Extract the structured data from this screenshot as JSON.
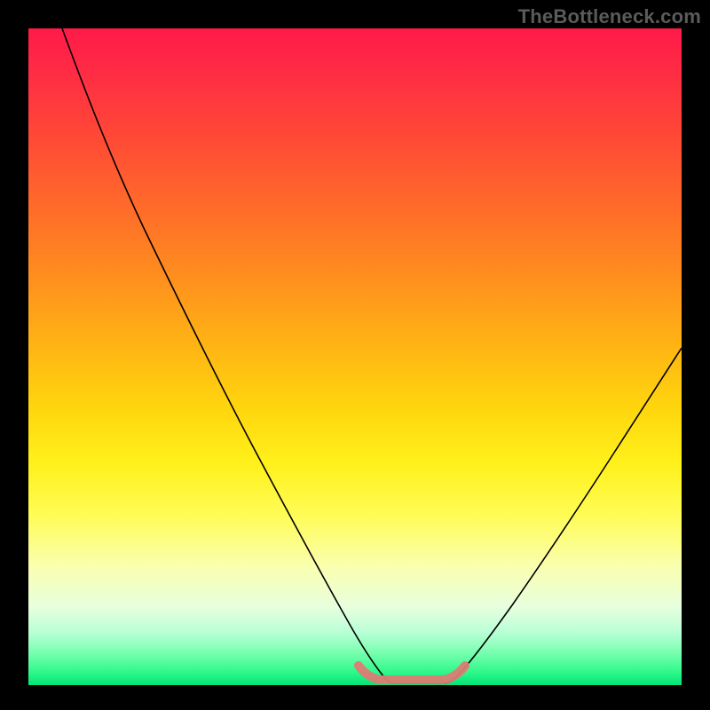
{
  "watermark": "TheBottleneck.com",
  "colors": {
    "background": "#000000",
    "gradient_top": "#ff1a48",
    "gradient_bottom": "#00e676",
    "curve": "#000000",
    "bottom_mark": "#de7b74"
  },
  "chart_data": {
    "type": "line",
    "title": "",
    "xlabel": "",
    "ylabel": "",
    "xlim": [
      0,
      100
    ],
    "ylim": [
      0,
      100
    ],
    "series": [
      {
        "name": "curve",
        "x": [
          5,
          10,
          15,
          20,
          25,
          30,
          35,
          40,
          45,
          48,
          50,
          53,
          55,
          58,
          60,
          63,
          65,
          70,
          75,
          80,
          85,
          90,
          95,
          100
        ],
        "y": [
          100,
          90,
          79,
          68,
          57,
          46,
          36,
          26,
          15,
          8,
          4,
          1,
          0,
          0,
          0,
          1,
          3,
          8,
          15,
          23,
          31,
          40,
          49,
          57
        ]
      },
      {
        "name": "valley-marker",
        "x": [
          50,
          53,
          55,
          58,
          60,
          63,
          65
        ],
        "y": [
          3,
          1,
          0,
          0,
          0,
          1,
          3
        ]
      }
    ]
  }
}
